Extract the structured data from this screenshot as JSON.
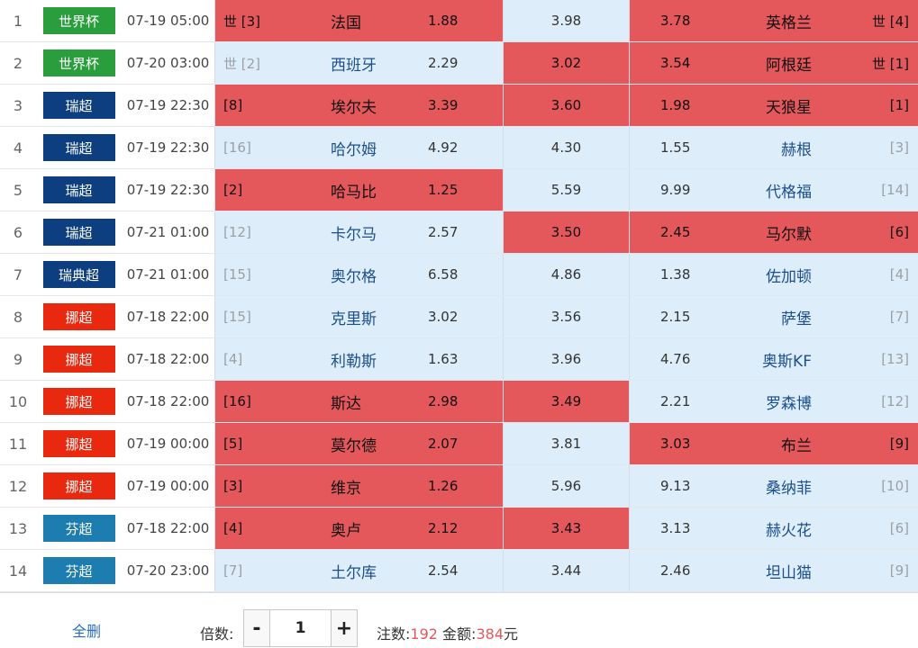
{
  "colors": {
    "selected": "#e4575a",
    "unselected": "#ddeefa",
    "world_cup": "#2a9d3c",
    "sweden": "#0d3f80",
    "norway": "#e8280f",
    "finland": "#1d7db1"
  },
  "matches": [
    {
      "index": "1",
      "league": "世界杯",
      "league_color": "#2a9d3c",
      "time": "07-19 05:00",
      "home_rank": "世 [3]",
      "home_team": "法国",
      "home_odd": "1.88",
      "draw_odd": "3.98",
      "away_odd": "3.78",
      "away_team": "英格兰",
      "away_rank": "世 [4]",
      "home_sel": true,
      "draw_sel": false,
      "away_sel": true
    },
    {
      "index": "2",
      "league": "世界杯",
      "league_color": "#2a9d3c",
      "time": "07-20 03:00",
      "home_rank": "世 [2]",
      "home_team": "西班牙",
      "home_odd": "2.29",
      "draw_odd": "3.02",
      "away_odd": "3.54",
      "away_team": "阿根廷",
      "away_rank": "世 [1]",
      "home_sel": false,
      "draw_sel": true,
      "away_sel": true
    },
    {
      "index": "3",
      "league": "瑞超",
      "league_color": "#0d3f80",
      "time": "07-19 22:30",
      "home_rank": "[8]",
      "home_team": "埃尔夫",
      "home_odd": "3.39",
      "draw_odd": "3.60",
      "away_odd": "1.98",
      "away_team": "天狼星",
      "away_rank": "[1]",
      "home_sel": true,
      "draw_sel": true,
      "away_sel": true
    },
    {
      "index": "4",
      "league": "瑞超",
      "league_color": "#0d3f80",
      "time": "07-19 22:30",
      "home_rank": "[16]",
      "home_team": "哈尔姆",
      "home_odd": "4.92",
      "draw_odd": "4.30",
      "away_odd": "1.55",
      "away_team": "赫根",
      "away_rank": "[3]",
      "home_sel": false,
      "draw_sel": false,
      "away_sel": false
    },
    {
      "index": "5",
      "league": "瑞超",
      "league_color": "#0d3f80",
      "time": "07-19 22:30",
      "home_rank": "[2]",
      "home_team": "哈马比",
      "home_odd": "1.25",
      "draw_odd": "5.59",
      "away_odd": "9.99",
      "away_team": "代格福",
      "away_rank": "[14]",
      "home_sel": true,
      "draw_sel": false,
      "away_sel": false
    },
    {
      "index": "6",
      "league": "瑞超",
      "league_color": "#0d3f80",
      "time": "07-21 01:00",
      "home_rank": "[12]",
      "home_team": "卡尔马",
      "home_odd": "2.57",
      "draw_odd": "3.50",
      "away_odd": "2.45",
      "away_team": "马尔默",
      "away_rank": "[6]",
      "home_sel": false,
      "draw_sel": true,
      "away_sel": true
    },
    {
      "index": "7",
      "league": "瑞典超",
      "league_color": "#0d3f80",
      "time": "07-21 01:00",
      "home_rank": "[15]",
      "home_team": "奥尔格",
      "home_odd": "6.58",
      "draw_odd": "4.86",
      "away_odd": "1.38",
      "away_team": "佐加顿",
      "away_rank": "[4]",
      "home_sel": false,
      "draw_sel": false,
      "away_sel": false
    },
    {
      "index": "8",
      "league": "挪超",
      "league_color": "#e8280f",
      "time": "07-18 22:00",
      "home_rank": "[15]",
      "home_team": "克里斯",
      "home_odd": "3.02",
      "draw_odd": "3.56",
      "away_odd": "2.15",
      "away_team": "萨堡",
      "away_rank": "[7]",
      "home_sel": false,
      "draw_sel": false,
      "away_sel": false
    },
    {
      "index": "9",
      "league": "挪超",
      "league_color": "#e8280f",
      "time": "07-18 22:00",
      "home_rank": "[4]",
      "home_team": "利勒斯",
      "home_odd": "1.63",
      "draw_odd": "3.96",
      "away_odd": "4.76",
      "away_team": "奥斯KF",
      "away_rank": "[13]",
      "home_sel": false,
      "draw_sel": false,
      "away_sel": false
    },
    {
      "index": "10",
      "league": "挪超",
      "league_color": "#e8280f",
      "time": "07-18 22:00",
      "home_rank": "[16]",
      "home_team": "斯达",
      "home_odd": "2.98",
      "draw_odd": "3.49",
      "away_odd": "2.21",
      "away_team": "罗森博",
      "away_rank": "[12]",
      "home_sel": true,
      "draw_sel": true,
      "away_sel": false
    },
    {
      "index": "11",
      "league": "挪超",
      "league_color": "#e8280f",
      "time": "07-19 00:00",
      "home_rank": "[5]",
      "home_team": "莫尔德",
      "home_odd": "2.07",
      "draw_odd": "3.81",
      "away_odd": "3.03",
      "away_team": "布兰",
      "away_rank": "[9]",
      "home_sel": true,
      "draw_sel": false,
      "away_sel": true
    },
    {
      "index": "12",
      "league": "挪超",
      "league_color": "#e8280f",
      "time": "07-19 00:00",
      "home_rank": "[3]",
      "home_team": "维京",
      "home_odd": "1.26",
      "draw_odd": "5.96",
      "away_odd": "9.13",
      "away_team": "桑纳菲",
      "away_rank": "[10]",
      "home_sel": true,
      "draw_sel": false,
      "away_sel": false
    },
    {
      "index": "13",
      "league": "芬超",
      "league_color": "#1d7db1",
      "time": "07-18 22:00",
      "home_rank": "[4]",
      "home_team": "奥卢",
      "home_odd": "2.12",
      "draw_odd": "3.43",
      "away_odd": "3.13",
      "away_team": "赫火花",
      "away_rank": "[6]",
      "home_sel": true,
      "draw_sel": true,
      "away_sel": false
    },
    {
      "index": "14",
      "league": "芬超",
      "league_color": "#1d7db1",
      "time": "07-20 23:00",
      "home_rank": "[7]",
      "home_team": "土尔库",
      "home_odd": "2.54",
      "draw_odd": "3.44",
      "away_odd": "2.46",
      "away_team": "坦山猫",
      "away_rank": "[9]",
      "home_sel": false,
      "draw_sel": false,
      "away_sel": false
    }
  ],
  "footer": {
    "delete_all": "全删",
    "multiplier_label": "倍数:",
    "minus": "-",
    "multiplier_value": "1",
    "plus": "+",
    "bets_label": "注数:",
    "bets_value": "192",
    "amount_label": "金额:",
    "amount_value": "384",
    "amount_unit": "元"
  }
}
